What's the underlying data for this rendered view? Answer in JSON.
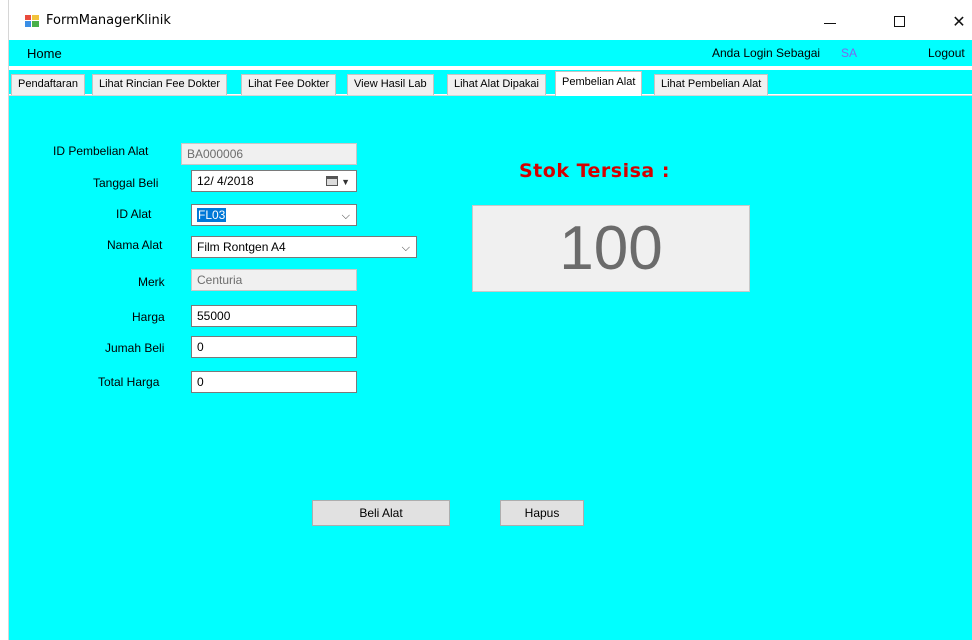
{
  "window": {
    "title": "FormManagerKlinik",
    "minimize_glyph": "—",
    "close_glyph": "✕"
  },
  "menu": {
    "home": "Home",
    "login_label": "Anda Login Sebagai",
    "login_user": "SA",
    "logout": "Logout"
  },
  "tabs": [
    {
      "label": "Pendaftaran"
    },
    {
      "label": "Lihat Rincian Fee Dokter"
    },
    {
      "label": "Lihat Fee Dokter"
    },
    {
      "label": "View Hasil Lab"
    },
    {
      "label": "Lihat Alat Dipakai"
    },
    {
      "label": "Pembelian Alat",
      "active": true
    },
    {
      "label": "Lihat Pembelian Alat"
    }
  ],
  "form": {
    "id_pembelian": {
      "label": "ID Pembelian Alat",
      "value": "BA000006"
    },
    "tanggal_beli": {
      "label": "Tanggal Beli",
      "value": "12/ 4/2018"
    },
    "id_alat": {
      "label": "ID Alat",
      "value": "FL03"
    },
    "nama_alat": {
      "label": "Nama Alat",
      "value": "Film Rontgen A4"
    },
    "merk": {
      "label": "Merk",
      "value": "Centuria"
    },
    "harga": {
      "label": "Harga",
      "value": "55000"
    },
    "jumlah_beli": {
      "label": "Jumah Beli",
      "value": "0"
    },
    "total_harga": {
      "label": "Total Harga",
      "value": "0"
    }
  },
  "stok": {
    "title": "Stok Tersisa :",
    "value": "100"
  },
  "buttons": {
    "beli": "Beli Alat",
    "hapus": "Hapus"
  },
  "colors": {
    "background": "#00ffff",
    "stok_title": "#d40000",
    "login_user": "#7b68ee"
  }
}
